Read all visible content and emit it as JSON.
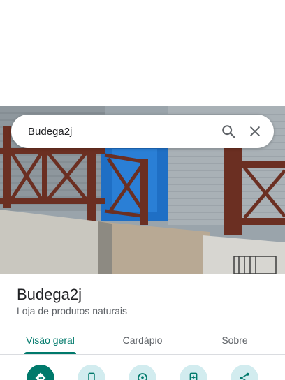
{
  "search": {
    "query": "Budega2j",
    "search_icon": "search-icon",
    "close_icon": "close-icon"
  },
  "place": {
    "name": "Budega2j",
    "category": "Loja de produtos naturais"
  },
  "tabs": [
    {
      "label": "Visão geral",
      "active": true
    },
    {
      "label": "Cardápio",
      "active": false
    },
    {
      "label": "Sobre",
      "active": false
    }
  ],
  "actions": [
    {
      "icon": "directions-icon"
    },
    {
      "icon": "phone-icon"
    },
    {
      "icon": "location-icon"
    },
    {
      "icon": "save-icon"
    },
    {
      "icon": "share-icon"
    }
  ],
  "colors": {
    "accent": "#00796b",
    "action_bg": "#d2ecef",
    "text_primary": "#202124",
    "text_secondary": "#5f6368"
  }
}
